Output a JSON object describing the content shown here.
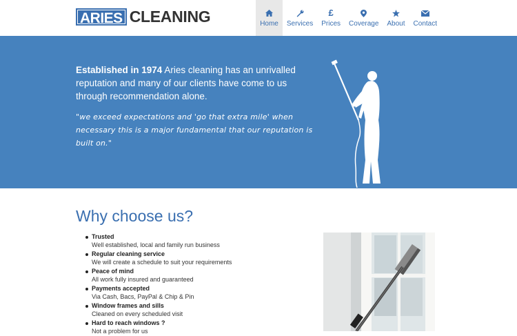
{
  "brand": {
    "box": "ARIES",
    "text": "CLEANING"
  },
  "nav": [
    {
      "label": "Home",
      "icon": "home-icon",
      "active": true
    },
    {
      "label": "Services",
      "icon": "wrench-icon",
      "active": false
    },
    {
      "label": "Prices",
      "icon": "pound-icon",
      "active": false
    },
    {
      "label": "Coverage",
      "icon": "map-pin-icon",
      "active": false
    },
    {
      "label": "About",
      "icon": "star-icon",
      "active": false
    },
    {
      "label": "Contact",
      "icon": "envelope-icon",
      "active": false
    }
  ],
  "hero": {
    "lead_bold": "Established in 1974",
    "lead_rest": " Aries cleaning has an unrivalled reputation and many of our clients have come to us through recommendation alone.",
    "quote": "\"we exceed expectations and 'go that extra mile' when necessary this is a major fundamental that our reputation is built on.\""
  },
  "why": {
    "title": "Why choose us?",
    "items": [
      {
        "title": "Trusted",
        "desc": "Well established, local and family run business"
      },
      {
        "title": "Regular cleaning service",
        "desc": "We will create a schedule to suit your requirements"
      },
      {
        "title": "Peace of mind",
        "desc": "All work fully insured and guaranteed"
      },
      {
        "title": "Payments accepted",
        "desc": "Via Cash, Bacs, PayPal & Chip & Pin"
      },
      {
        "title": "Window frames and sills",
        "desc": "Cleaned on every scheduled visit"
      },
      {
        "title": "Hard to reach windows ?",
        "desc": "Not a problem for us"
      }
    ]
  },
  "colors": {
    "brand_blue": "#3a6fb0",
    "hero_bg": "#4682be",
    "nav_active_bg": "#e8e8e8"
  }
}
